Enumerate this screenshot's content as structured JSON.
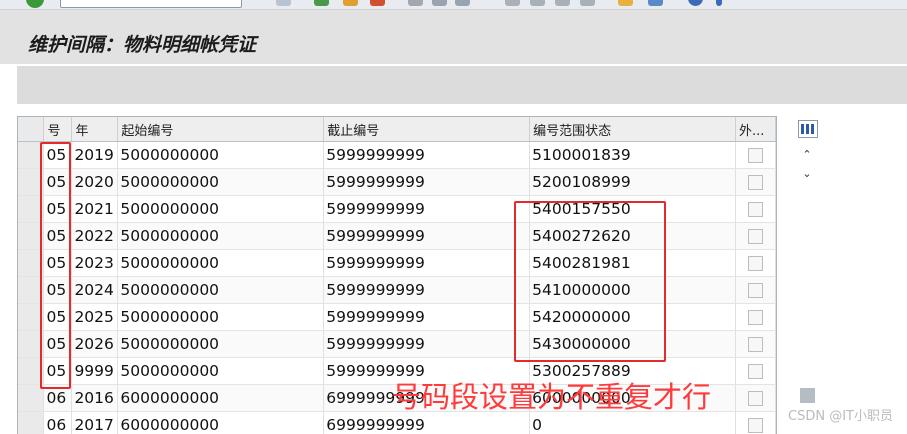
{
  "window": {
    "title": "维护间隔：物料明细帐凭证"
  },
  "toolbar": {
    "icon_names": [
      "confirm-icon",
      "save-icon",
      "back-icon",
      "exit-icon",
      "cancel-icon",
      "print-icon",
      "find-icon",
      "find-next-icon",
      "first-page-icon",
      "prev-page-icon",
      "next-page-icon",
      "last-page-icon",
      "new-session-icon",
      "shortcut-icon",
      "help-icon",
      "customize-icon"
    ]
  },
  "table": {
    "columns": [
      "号",
      "年",
      "起始编号",
      "截止编号",
      "编号范围状态",
      "外..."
    ],
    "rows": [
      {
        "no": "05",
        "year": "2019",
        "from": "5000000000",
        "to": "5999999999",
        "status": "5100001839"
      },
      {
        "no": "05",
        "year": "2020",
        "from": "5000000000",
        "to": "5999999999",
        "status": "5200108999"
      },
      {
        "no": "05",
        "year": "2021",
        "from": "5000000000",
        "to": "5999999999",
        "status": "5400157550"
      },
      {
        "no": "05",
        "year": "2022",
        "from": "5000000000",
        "to": "5999999999",
        "status": "5400272620"
      },
      {
        "no": "05",
        "year": "2023",
        "from": "5000000000",
        "to": "5999999999",
        "status": "5400281981"
      },
      {
        "no": "05",
        "year": "2024",
        "from": "5000000000",
        "to": "5999999999",
        "status": "5410000000"
      },
      {
        "no": "05",
        "year": "2025",
        "from": "5000000000",
        "to": "5999999999",
        "status": "5420000000"
      },
      {
        "no": "05",
        "year": "2026",
        "from": "5000000000",
        "to": "5999999999",
        "status": "5430000000"
      },
      {
        "no": "05",
        "year": "9999",
        "from": "5000000000",
        "to": "5999999999",
        "status": "5300257889"
      },
      {
        "no": "06",
        "year": "2016",
        "from": "6000000000",
        "to": "6999999999",
        "status": "6000000000"
      },
      {
        "no": "06",
        "year": "2017",
        "from": "6000000000",
        "to": "6999999999",
        "status": "0"
      }
    ]
  },
  "annotation": {
    "note": "号码段设置为不重复才行",
    "color": "#ff3a3a"
  },
  "watermark": "CSDN @IT小职员",
  "colors": {
    "highlight_box": "#e52a2a",
    "header_bg": "#eeeeee",
    "title_bar_bg": "#e2e2e2"
  }
}
